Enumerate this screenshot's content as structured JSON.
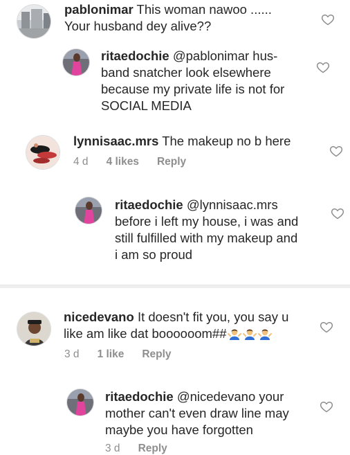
{
  "comments": [
    {
      "username": "pablonimar",
      "text": "This woman nawoo ......\nYour husband dey alive??",
      "avatar": "building-photo"
    },
    {
      "username": "ritaedochie",
      "text": "@pablonimar hus-\nband snatcher look elsewhere\nbecause my private life is not for\nSOCIAL MEDIA",
      "avatar": "woman-pink-dress-photo"
    },
    {
      "username": "lynnisaac.mrs",
      "text": "The makeup no b here",
      "time": "4 d",
      "likes": "4 likes",
      "reply": "Reply",
      "avatar": "makeup-palette-photo"
    },
    {
      "username": "ritaedochie",
      "text": "@lynnisaac.mrs\nbefore i left my house, i was and\nstill fulfilled with my makeup and\ni am so proud",
      "avatar": "woman-pink-dress-photo"
    },
    {
      "username": "nicedevano",
      "text": "It doesn't fit you, you say u\nlike am like dat boooooom##",
      "emojis": [
        "person-shrugging-emoji",
        "person-shrugging-emoji",
        "person-shrugging-emoji"
      ],
      "time": "3 d",
      "likes": "1 like",
      "reply": "Reply",
      "avatar": "man-in-cap-photo"
    },
    {
      "username": "ritaedochie",
      "text": "@nicedevano your\nmother can't even draw line may\nmaybe you have forgotten",
      "time": "3 d",
      "reply": "Reply",
      "avatar": "woman-pink-dress-photo"
    }
  ],
  "colors": {
    "text": "#262626",
    "meta": "#8e8e8e",
    "heart": "#8e8e8e",
    "divider": "#efefef"
  },
  "icons": {
    "like": "heart-outline-icon"
  }
}
